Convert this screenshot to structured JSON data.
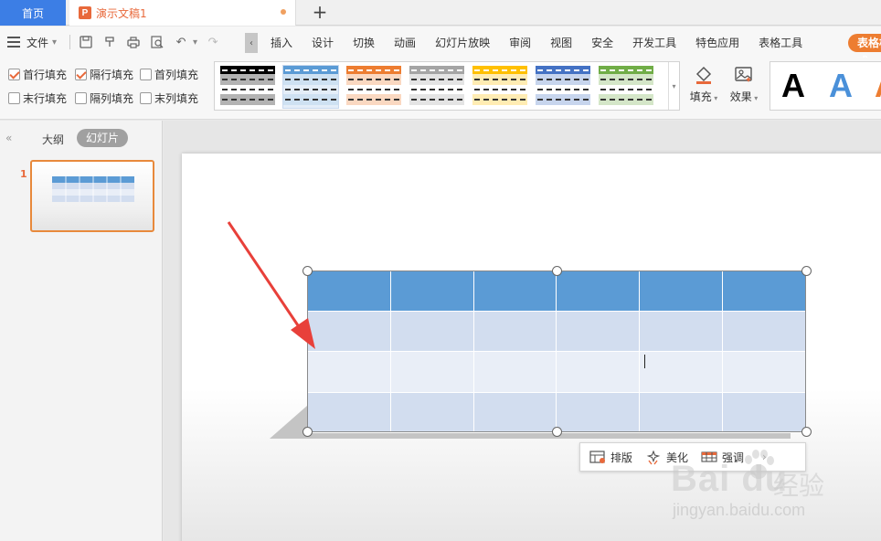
{
  "titlebar": {
    "home_tab": "首页",
    "doc_icon": "P",
    "doc_title": "演示文稿1",
    "add_tab": "+"
  },
  "menubar": {
    "file_label": "文件",
    "items": [
      "插入",
      "设计",
      "切换",
      "动画",
      "幻灯片放映",
      "审阅",
      "视图",
      "安全",
      "开发工具",
      "特色应用",
      "表格工具"
    ],
    "active_context": "表格样式"
  },
  "ribbon": {
    "checkboxes": [
      {
        "label": "首行填充",
        "checked": true
      },
      {
        "label": "隔行填充",
        "checked": true
      },
      {
        "label": "首列填充",
        "checked": false
      },
      {
        "label": "末行填充",
        "checked": false
      },
      {
        "label": "隔列填充",
        "checked": false
      },
      {
        "label": "末列填充",
        "checked": false
      }
    ],
    "style_colors": [
      "#000000",
      "#5b9bd5",
      "#ed7d31",
      "#a5a5a5",
      "#ffc000",
      "#4472c4",
      "#70ad47"
    ],
    "fill_label": "填充",
    "effect_label": "效果",
    "wordart_letter": "A",
    "wordart_colors": [
      "#000000",
      "#4a90d9",
      "#ed7d31"
    ]
  },
  "leftpanel": {
    "outline_tab": "大纲",
    "slides_tab": "幻灯片",
    "slide_number": "1"
  },
  "table": {
    "rows": 4,
    "cols": 6,
    "header_color": "#5b9bd5",
    "band_color": "#d2ddef",
    "alt_color": "#e9eef7"
  },
  "floatbar": {
    "layout_label": "排版",
    "beautify_label": "美化",
    "emphasis_label": "强调"
  },
  "watermark": {
    "logo": "Bai du",
    "cn": "经验",
    "url": "jingyan.baidu.com"
  }
}
